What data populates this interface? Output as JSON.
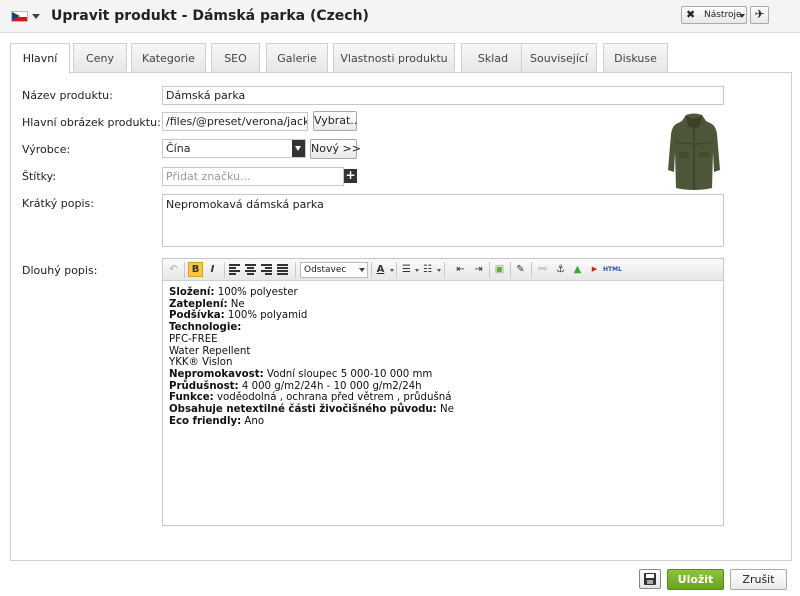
{
  "header": {
    "title": "Upravit produkt - Dámská parka (Czech)",
    "flag_icon": "czech-flag-icon",
    "tools_label": "Nástroje",
    "colors": {
      "flag_red": "#d7141a",
      "flag_blue": "#11457e"
    }
  },
  "tabs": [
    {
      "label": "Hlavní",
      "active": true
    },
    {
      "label": "Ceny"
    },
    {
      "label": "Kategorie"
    },
    {
      "label": "SEO"
    },
    {
      "label": "Galerie"
    },
    {
      "label": "Vlastnosti produktu"
    },
    {
      "label": "Sklad"
    },
    {
      "label": "Související"
    },
    {
      "label": "Diskuse"
    }
  ],
  "form": {
    "name_label": "Název produktu:",
    "name_value": "Dámská parka",
    "image_label": "Hlavní obrázek produktu:",
    "image_value": "/files/@preset/verona/jackets/",
    "image_button": "Vybrat..",
    "maker_label": "Výrobce:",
    "maker_value": "Čína",
    "maker_button": "Nový >>",
    "tags_label": "Štítky:",
    "tags_placeholder": "Přidat značku...",
    "short_label": "Krátký popis:",
    "short_value": "Nepromokavá dámská parka",
    "long_label": "Dlouhý popis:"
  },
  "editor": {
    "format_select": "Odstavec",
    "toolbar": {
      "bold": "B",
      "italic": "I",
      "html": "HTML",
      "font_color": "A"
    },
    "lines": [
      {
        "bold": "Složení:",
        "text": " 100% polyester"
      },
      {
        "bold": "Zateplení:",
        "text": " Ne"
      },
      {
        "bold": "Podšívka:",
        "text": " 100% polyamid"
      },
      {
        "bold": "Technologie:",
        "text": ""
      },
      {
        "bold": "",
        "text": "PFC-FREE"
      },
      {
        "bold": "",
        "text": "Water Repellent"
      },
      {
        "bold": "",
        "text": "YKK® Vislon"
      },
      {
        "bold": "Nepromokavost:",
        "text": " Vodní sloupec 5 000-10 000 mm"
      },
      {
        "bold": "Průdušnost:",
        "text": " 4 000 g/m2/24h - 10 000 g/m2/24h"
      },
      {
        "bold": "Funkce:",
        "text": " voděodolná , ochrana před větrem , průdušná"
      },
      {
        "bold": "Obsahuje netextilné části živočišného původu:",
        "text": " Ne"
      },
      {
        "bold": "Eco friendly:",
        "text": " Ano"
      }
    ]
  },
  "footer": {
    "save_label": "Uložit",
    "cancel_label": "Zrušit",
    "accent_color": "#7ab32e"
  }
}
